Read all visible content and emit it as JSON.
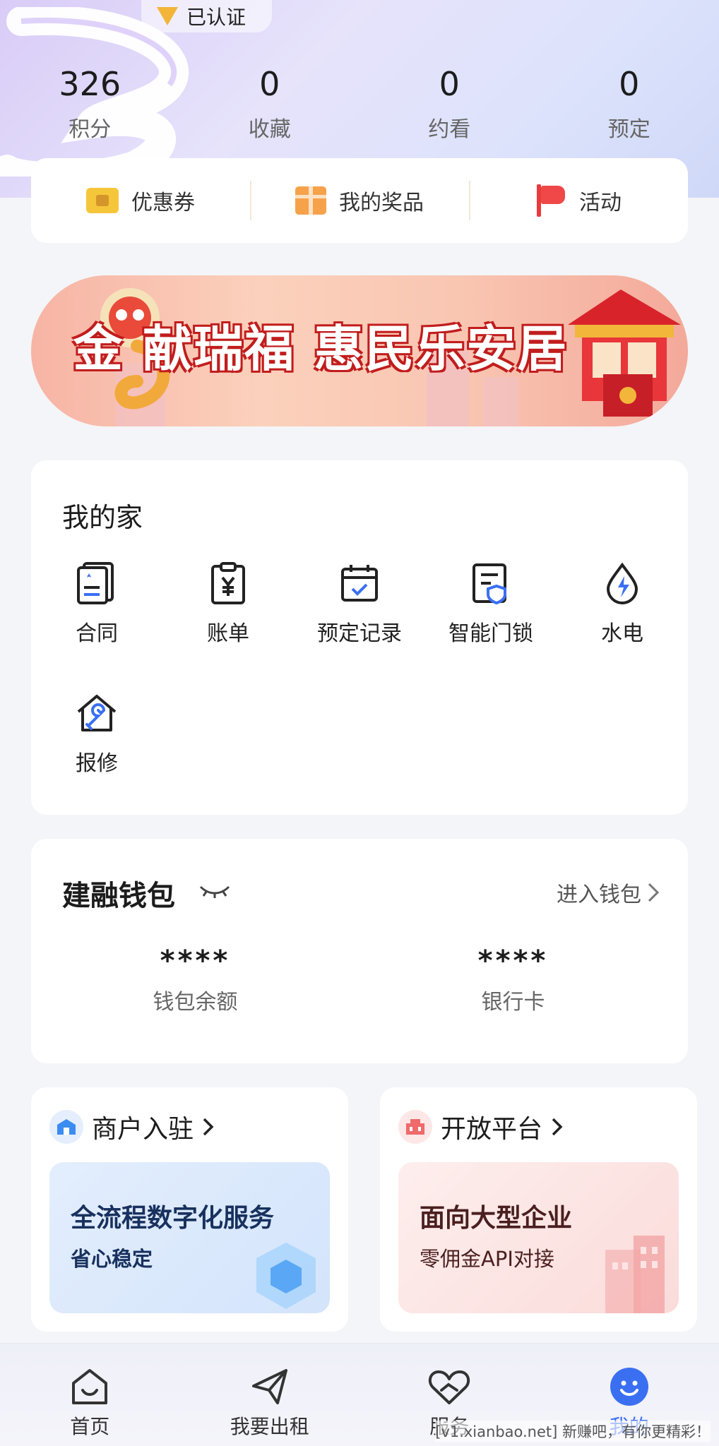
{
  "header": {
    "verified_label": "已认证",
    "stats": [
      {
        "value": "326",
        "label": "积分"
      },
      {
        "value": "0",
        "label": "收藏"
      },
      {
        "value": "0",
        "label": "约看"
      },
      {
        "value": "0",
        "label": "预定"
      }
    ]
  },
  "quick_links": [
    {
      "label": "优惠券",
      "icon": "coupon-icon"
    },
    {
      "label": "我的奖品",
      "icon": "gift-icon"
    },
    {
      "label": "活动",
      "icon": "flag-icon"
    }
  ],
  "banner": {
    "text": "金 献瑞福 惠民乐安居"
  },
  "my_home": {
    "title": "我的家",
    "items": [
      {
        "label": "合同",
        "icon": "contract-icon"
      },
      {
        "label": "账单",
        "icon": "bill-icon"
      },
      {
        "label": "预定记录",
        "icon": "calendar-check-icon"
      },
      {
        "label": "智能门锁",
        "icon": "smart-lock-icon"
      },
      {
        "label": "水电",
        "icon": "water-electric-icon"
      },
      {
        "label": "报修",
        "icon": "repair-icon"
      }
    ]
  },
  "wallet": {
    "title": "建融钱包",
    "link_label": "进入钱包",
    "balance_value": "****",
    "balance_label": "钱包余额",
    "card_value": "****",
    "card_label": "银行卡"
  },
  "merchant": {
    "title": "商户入驻",
    "headline": "全流程数字化服务",
    "sub": "省心稳定"
  },
  "open_platform": {
    "title": "开放平台",
    "headline": "面向大型企业",
    "sub": "零佣金API对接"
  },
  "tabbar": {
    "tabs": [
      {
        "label": "首页",
        "icon": "home-icon"
      },
      {
        "label": "我要出租",
        "icon": "send-icon"
      },
      {
        "label": "服务",
        "icon": "heart-hand-icon"
      },
      {
        "label": "我的",
        "icon": "smile-icon"
      }
    ],
    "active": "我的"
  },
  "watermark": "[v1.xianbao.net] 新赚吧，有你更精彩！",
  "colors": {
    "accent": "#3b6ff2",
    "banner_red": "#c11d1d"
  }
}
